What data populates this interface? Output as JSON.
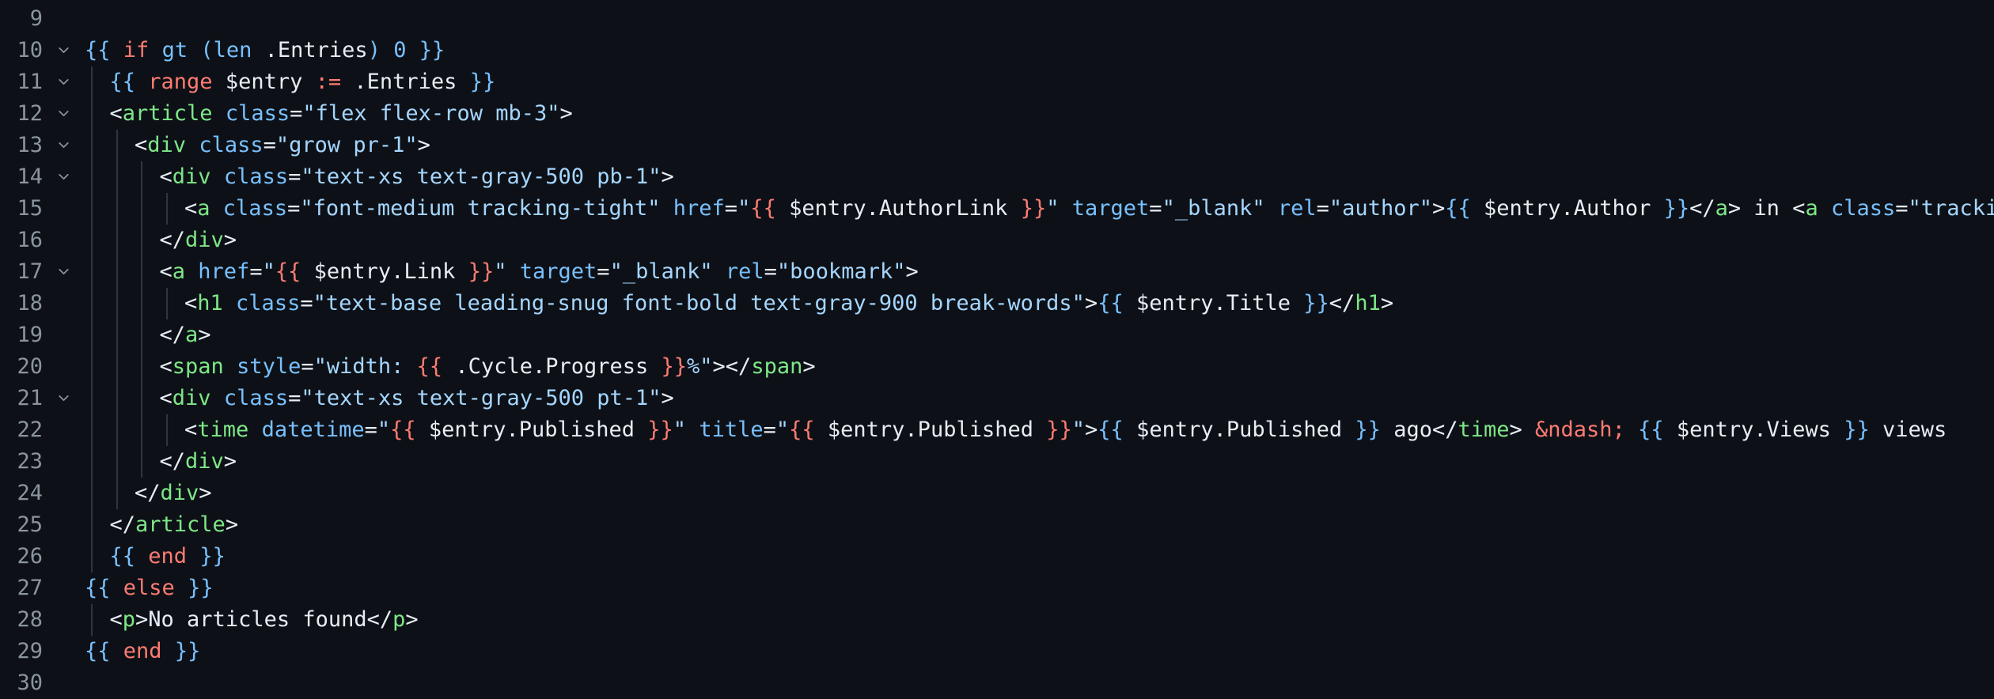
{
  "editor": {
    "colors": {
      "background": "#0d1117",
      "line_number": "#8b949e",
      "plain": "#e6edf3",
      "delimiter": "#79c0ff",
      "keyword": "#ff7b72",
      "tag": "#7ee787",
      "attribute": "#79c0ff",
      "string": "#a5d6ff"
    },
    "lines": [
      {
        "num": "9",
        "indent": 0,
        "fold": false,
        "tokens": []
      },
      {
        "num": "10",
        "indent": 0,
        "fold": true,
        "tokens": [
          {
            "t": "{{ ",
            "c": "d"
          },
          {
            "t": "if",
            "c": "k"
          },
          {
            "t": " ",
            "c": "p"
          },
          {
            "t": "gt",
            "c": "f"
          },
          {
            "t": " (",
            "c": "d"
          },
          {
            "t": "len",
            "c": "f"
          },
          {
            "t": " .Entries",
            "c": "p"
          },
          {
            "t": ")",
            "c": "d"
          },
          {
            "t": " 0",
            "c": "n"
          },
          {
            "t": " }}",
            "c": "d"
          }
        ]
      },
      {
        "num": "11",
        "indent": 1,
        "fold": true,
        "tokens": [
          {
            "t": "{{ ",
            "c": "d"
          },
          {
            "t": "range",
            "c": "k"
          },
          {
            "t": " $entry ",
            "c": "p"
          },
          {
            "t": ":=",
            "c": "o"
          },
          {
            "t": " .Entries",
            "c": "p"
          },
          {
            "t": " }}",
            "c": "d"
          }
        ]
      },
      {
        "num": "12",
        "indent": 1,
        "fold": true,
        "tokens": [
          {
            "t": "<",
            "c": "p"
          },
          {
            "t": "article",
            "c": "t"
          },
          {
            "t": " ",
            "c": "p"
          },
          {
            "t": "class",
            "c": "a"
          },
          {
            "t": "=",
            "c": "p"
          },
          {
            "t": "\"flex flex-row mb-3\"",
            "c": "s"
          },
          {
            "t": ">",
            "c": "p"
          }
        ]
      },
      {
        "num": "13",
        "indent": 2,
        "fold": true,
        "tokens": [
          {
            "t": "<",
            "c": "p"
          },
          {
            "t": "div",
            "c": "t"
          },
          {
            "t": " ",
            "c": "p"
          },
          {
            "t": "class",
            "c": "a"
          },
          {
            "t": "=",
            "c": "p"
          },
          {
            "t": "\"grow pr-1\"",
            "c": "s"
          },
          {
            "t": ">",
            "c": "p"
          }
        ]
      },
      {
        "num": "14",
        "indent": 3,
        "fold": true,
        "tokens": [
          {
            "t": "<",
            "c": "p"
          },
          {
            "t": "div",
            "c": "t"
          },
          {
            "t": " ",
            "c": "p"
          },
          {
            "t": "class",
            "c": "a"
          },
          {
            "t": "=",
            "c": "p"
          },
          {
            "t": "\"text-xs text-gray-500 pb-1\"",
            "c": "s"
          },
          {
            "t": ">",
            "c": "p"
          }
        ]
      },
      {
        "num": "15",
        "indent": 4,
        "fold": false,
        "tokens": [
          {
            "t": "<",
            "c": "p"
          },
          {
            "t": "a",
            "c": "t"
          },
          {
            "t": " ",
            "c": "p"
          },
          {
            "t": "class",
            "c": "a"
          },
          {
            "t": "=",
            "c": "p"
          },
          {
            "t": "\"font-medium tracking-tight\"",
            "c": "s"
          },
          {
            "t": " ",
            "c": "p"
          },
          {
            "t": "href",
            "c": "a"
          },
          {
            "t": "=",
            "c": "p"
          },
          {
            "t": "\"",
            "c": "s"
          },
          {
            "t": "{{",
            "c": "k"
          },
          {
            "t": " $entry.AuthorLink ",
            "c": "p"
          },
          {
            "t": "}}",
            "c": "k"
          },
          {
            "t": "\"",
            "c": "s"
          },
          {
            "t": " ",
            "c": "p"
          },
          {
            "t": "target",
            "c": "a"
          },
          {
            "t": "=",
            "c": "p"
          },
          {
            "t": "\"_blank\"",
            "c": "s"
          },
          {
            "t": " ",
            "c": "p"
          },
          {
            "t": "rel",
            "c": "a"
          },
          {
            "t": "=",
            "c": "p"
          },
          {
            "t": "\"author\"",
            "c": "s"
          },
          {
            "t": ">",
            "c": "p"
          },
          {
            "t": "{{",
            "c": "d"
          },
          {
            "t": " $entry.Author ",
            "c": "p"
          },
          {
            "t": "}}",
            "c": "d"
          },
          {
            "t": "</",
            "c": "p"
          },
          {
            "t": "a",
            "c": "t"
          },
          {
            "t": "> in <",
            "c": "p"
          },
          {
            "t": "a",
            "c": "t"
          },
          {
            "t": " ",
            "c": "p"
          },
          {
            "t": "class",
            "c": "a"
          },
          {
            "t": "=",
            "c": "p"
          },
          {
            "t": "\"tracking-ti",
            "c": "s"
          }
        ]
      },
      {
        "num": "16",
        "indent": 3,
        "fold": false,
        "tokens": [
          {
            "t": "</",
            "c": "p"
          },
          {
            "t": "div",
            "c": "t"
          },
          {
            "t": ">",
            "c": "p"
          }
        ]
      },
      {
        "num": "17",
        "indent": 3,
        "fold": true,
        "tokens": [
          {
            "t": "<",
            "c": "p"
          },
          {
            "t": "a",
            "c": "t"
          },
          {
            "t": " ",
            "c": "p"
          },
          {
            "t": "href",
            "c": "a"
          },
          {
            "t": "=",
            "c": "p"
          },
          {
            "t": "\"",
            "c": "s"
          },
          {
            "t": "{{",
            "c": "k"
          },
          {
            "t": " $entry.Link ",
            "c": "p"
          },
          {
            "t": "}}",
            "c": "k"
          },
          {
            "t": "\"",
            "c": "s"
          },
          {
            "t": " ",
            "c": "p"
          },
          {
            "t": "target",
            "c": "a"
          },
          {
            "t": "=",
            "c": "p"
          },
          {
            "t": "\"_blank\"",
            "c": "s"
          },
          {
            "t": " ",
            "c": "p"
          },
          {
            "t": "rel",
            "c": "a"
          },
          {
            "t": "=",
            "c": "p"
          },
          {
            "t": "\"bookmark\"",
            "c": "s"
          },
          {
            "t": ">",
            "c": "p"
          }
        ]
      },
      {
        "num": "18",
        "indent": 4,
        "fold": false,
        "tokens": [
          {
            "t": "<",
            "c": "p"
          },
          {
            "t": "h1",
            "c": "t"
          },
          {
            "t": " ",
            "c": "p"
          },
          {
            "t": "class",
            "c": "a"
          },
          {
            "t": "=",
            "c": "p"
          },
          {
            "t": "\"text-base leading-snug font-bold text-gray-900 break-words\"",
            "c": "s"
          },
          {
            "t": ">",
            "c": "p"
          },
          {
            "t": "{{",
            "c": "d"
          },
          {
            "t": " $entry.Title ",
            "c": "p"
          },
          {
            "t": "}}",
            "c": "d"
          },
          {
            "t": "</",
            "c": "p"
          },
          {
            "t": "h1",
            "c": "t"
          },
          {
            "t": ">",
            "c": "p"
          }
        ]
      },
      {
        "num": "19",
        "indent": 3,
        "fold": false,
        "tokens": [
          {
            "t": "</",
            "c": "p"
          },
          {
            "t": "a",
            "c": "t"
          },
          {
            "t": ">",
            "c": "p"
          }
        ]
      },
      {
        "num": "20",
        "indent": 3,
        "fold": false,
        "tokens": [
          {
            "t": "<",
            "c": "p"
          },
          {
            "t": "span",
            "c": "t"
          },
          {
            "t": " ",
            "c": "p"
          },
          {
            "t": "style",
            "c": "a"
          },
          {
            "t": "=",
            "c": "p"
          },
          {
            "t": "\"width: ",
            "c": "s"
          },
          {
            "t": "{{",
            "c": "k"
          },
          {
            "t": " .Cycle.Progress ",
            "c": "p"
          },
          {
            "t": "}}",
            "c": "k"
          },
          {
            "t": "%\"",
            "c": "s"
          },
          {
            "t": "></",
            "c": "p"
          },
          {
            "t": "span",
            "c": "t"
          },
          {
            "t": ">",
            "c": "p"
          }
        ]
      },
      {
        "num": "21",
        "indent": 3,
        "fold": true,
        "tokens": [
          {
            "t": "<",
            "c": "p"
          },
          {
            "t": "div",
            "c": "t"
          },
          {
            "t": " ",
            "c": "p"
          },
          {
            "t": "class",
            "c": "a"
          },
          {
            "t": "=",
            "c": "p"
          },
          {
            "t": "\"text-xs text-gray-500 pt-1\"",
            "c": "s"
          },
          {
            "t": ">",
            "c": "p"
          }
        ]
      },
      {
        "num": "22",
        "indent": 4,
        "fold": false,
        "tokens": [
          {
            "t": "<",
            "c": "p"
          },
          {
            "t": "time",
            "c": "t"
          },
          {
            "t": " ",
            "c": "p"
          },
          {
            "t": "datetime",
            "c": "a"
          },
          {
            "t": "=",
            "c": "p"
          },
          {
            "t": "\"",
            "c": "s"
          },
          {
            "t": "{{",
            "c": "k"
          },
          {
            "t": " $entry.Published ",
            "c": "p"
          },
          {
            "t": "}}",
            "c": "k"
          },
          {
            "t": "\"",
            "c": "s"
          },
          {
            "t": " ",
            "c": "p"
          },
          {
            "t": "title",
            "c": "a"
          },
          {
            "t": "=",
            "c": "p"
          },
          {
            "t": "\"",
            "c": "s"
          },
          {
            "t": "{{",
            "c": "k"
          },
          {
            "t": " $entry.Published ",
            "c": "p"
          },
          {
            "t": "}}",
            "c": "k"
          },
          {
            "t": "\"",
            "c": "s"
          },
          {
            "t": ">",
            "c": "p"
          },
          {
            "t": "{{",
            "c": "d"
          },
          {
            "t": " $entry.Published ",
            "c": "p"
          },
          {
            "t": "}}",
            "c": "d"
          },
          {
            "t": " ago</",
            "c": "p"
          },
          {
            "t": "time",
            "c": "t"
          },
          {
            "t": "> ",
            "c": "p"
          },
          {
            "t": "&ndash;",
            "c": "k"
          },
          {
            "t": " ",
            "c": "p"
          },
          {
            "t": "{{",
            "c": "d"
          },
          {
            "t": " $entry.Views ",
            "c": "p"
          },
          {
            "t": "}}",
            "c": "d"
          },
          {
            "t": " views",
            "c": "p"
          }
        ]
      },
      {
        "num": "23",
        "indent": 3,
        "fold": false,
        "tokens": [
          {
            "t": "</",
            "c": "p"
          },
          {
            "t": "div",
            "c": "t"
          },
          {
            "t": ">",
            "c": "p"
          }
        ]
      },
      {
        "num": "24",
        "indent": 2,
        "fold": false,
        "tokens": [
          {
            "t": "</",
            "c": "p"
          },
          {
            "t": "div",
            "c": "t"
          },
          {
            "t": ">",
            "c": "p"
          }
        ]
      },
      {
        "num": "25",
        "indent": 1,
        "fold": false,
        "tokens": [
          {
            "t": "</",
            "c": "p"
          },
          {
            "t": "article",
            "c": "t"
          },
          {
            "t": ">",
            "c": "p"
          }
        ]
      },
      {
        "num": "26",
        "indent": 1,
        "fold": false,
        "tokens": [
          {
            "t": "{{ ",
            "c": "d"
          },
          {
            "t": "end",
            "c": "k"
          },
          {
            "t": " }}",
            "c": "d"
          }
        ]
      },
      {
        "num": "27",
        "indent": 0,
        "fold": false,
        "tokens": [
          {
            "t": "{{ ",
            "c": "d"
          },
          {
            "t": "else",
            "c": "k"
          },
          {
            "t": " }}",
            "c": "d"
          }
        ]
      },
      {
        "num": "28",
        "indent": 1,
        "fold": false,
        "tokens": [
          {
            "t": "<",
            "c": "p"
          },
          {
            "t": "p",
            "c": "t"
          },
          {
            "t": ">No articles found</",
            "c": "p"
          },
          {
            "t": "p",
            "c": "t"
          },
          {
            "t": ">",
            "c": "p"
          }
        ]
      },
      {
        "num": "29",
        "indent": 0,
        "fold": false,
        "tokens": [
          {
            "t": "{{ ",
            "c": "d"
          },
          {
            "t": "end",
            "c": "k"
          },
          {
            "t": " }}",
            "c": "d"
          }
        ]
      },
      {
        "num": "30",
        "indent": 0,
        "fold": false,
        "tokens": []
      }
    ]
  }
}
